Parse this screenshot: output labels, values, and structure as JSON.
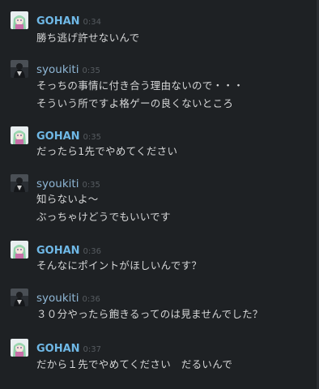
{
  "colors": {
    "background": "#1e2124",
    "gohan_name": "#6fb8e6",
    "syoukiti_name": "#8fb7d6",
    "timestamp": "#565b60",
    "message_text": "#d6d7d8"
  },
  "messages": [
    {
      "author": "GOHAN",
      "time": "0:34",
      "avatar_icon": "anime-girl-avatar-icon",
      "lines": [
        "勝ち逃げ許せないんで"
      ]
    },
    {
      "author": "syoukiti",
      "time": "0:35",
      "avatar_icon": "dark-figure-avatar-icon",
      "lines": [
        "そっちの事情に付き合う理由ないので・・・",
        "そういう所ですよ格ゲーの良くないところ"
      ]
    },
    {
      "author": "GOHAN",
      "time": "0:35",
      "avatar_icon": "anime-girl-avatar-icon",
      "lines": [
        "だったら1先でやめてください"
      ]
    },
    {
      "author": "syoukiti",
      "time": "0:35",
      "avatar_icon": "dark-figure-avatar-icon",
      "lines": [
        "知らないよ～",
        "ぶっちゃけどうでもいいです"
      ]
    },
    {
      "author": "GOHAN",
      "time": "0:36",
      "avatar_icon": "anime-girl-avatar-icon",
      "lines": [
        "そんなにポイントがほしいんです？"
      ]
    },
    {
      "author": "syoukiti",
      "time": "0:36",
      "avatar_icon": "dark-figure-avatar-icon",
      "lines": [
        "３０分やったら飽きるってのは見ませんでした？"
      ]
    },
    {
      "author": "GOHAN",
      "time": "0:37",
      "avatar_icon": "anime-girl-avatar-icon",
      "lines": [
        "だから１先でやめてください　だるいんで"
      ]
    }
  ]
}
